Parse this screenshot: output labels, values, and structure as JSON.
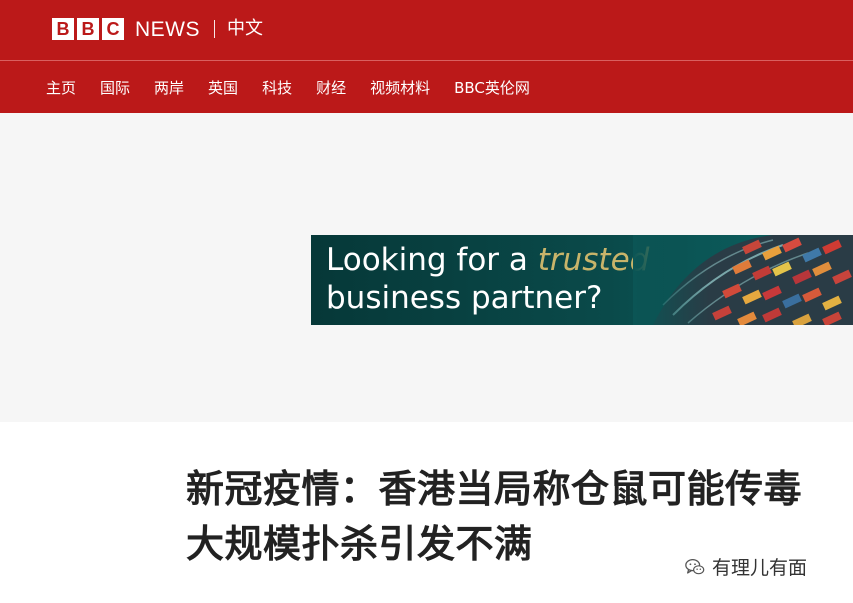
{
  "header": {
    "brand_letters": [
      "B",
      "B",
      "C"
    ],
    "brand_news": "NEWS",
    "language": "中文",
    "background_color": "#bb1919"
  },
  "nav": {
    "items": [
      "主页",
      "国际",
      "两岸",
      "英国",
      "科技",
      "财经",
      "视频材料",
      "BBC英伦网"
    ]
  },
  "ad": {
    "line1_prefix": "Looking for a ",
    "line1_accent": "trusted",
    "line2": "business partner?"
  },
  "article": {
    "headline": "新冠疫情：香港当局称仓鼠可能传毒 大规模扑杀引发不满"
  },
  "watermark": {
    "icon": "wechat-icon",
    "text": "有理儿有面"
  }
}
